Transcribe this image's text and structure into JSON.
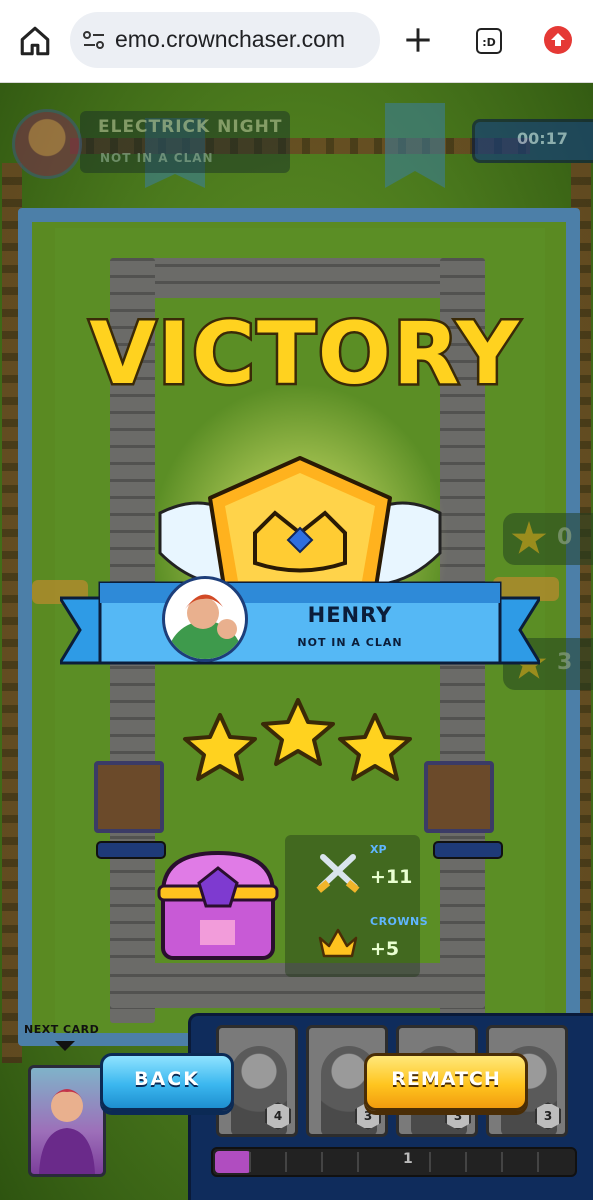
{
  "browser": {
    "url": "emo.crownchaser.com",
    "tabs_icon_text": ":D"
  },
  "hud": {
    "opponent_name": "ELECTRICK NIGHT",
    "opponent_clan": "NOT IN A CLAN",
    "timer": "00:17",
    "opponent_score": "0",
    "player_score": "3"
  },
  "result": {
    "title": "VICTORY",
    "player_name": "HENRY",
    "player_clan": "NOT IN A CLAN",
    "stars_earned": 3,
    "stars_total": 3
  },
  "rewards": {
    "xp_label": "XP",
    "xp_value": "+11",
    "crowns_label": "CROWNS",
    "crowns_value": "+5"
  },
  "deck": {
    "next_card_label": "NEXT CARD",
    "cards": [
      {
        "name": "card-1",
        "cost": "4"
      },
      {
        "name": "card-2",
        "cost": "3"
      },
      {
        "name": "card-3",
        "cost": "3"
      },
      {
        "name": "card-4",
        "cost": "3"
      }
    ],
    "elixir_count": "1",
    "elixir_fraction": 0.1
  },
  "buttons": {
    "back": "BACK",
    "rematch": "REMATCH"
  },
  "colors": {
    "back_button": "#3bb7ef",
    "rematch_button": "#ffc51f",
    "victory_text": "#ffd21f",
    "ribbon": "#2e9be6",
    "elixir": "#b04dc0"
  }
}
